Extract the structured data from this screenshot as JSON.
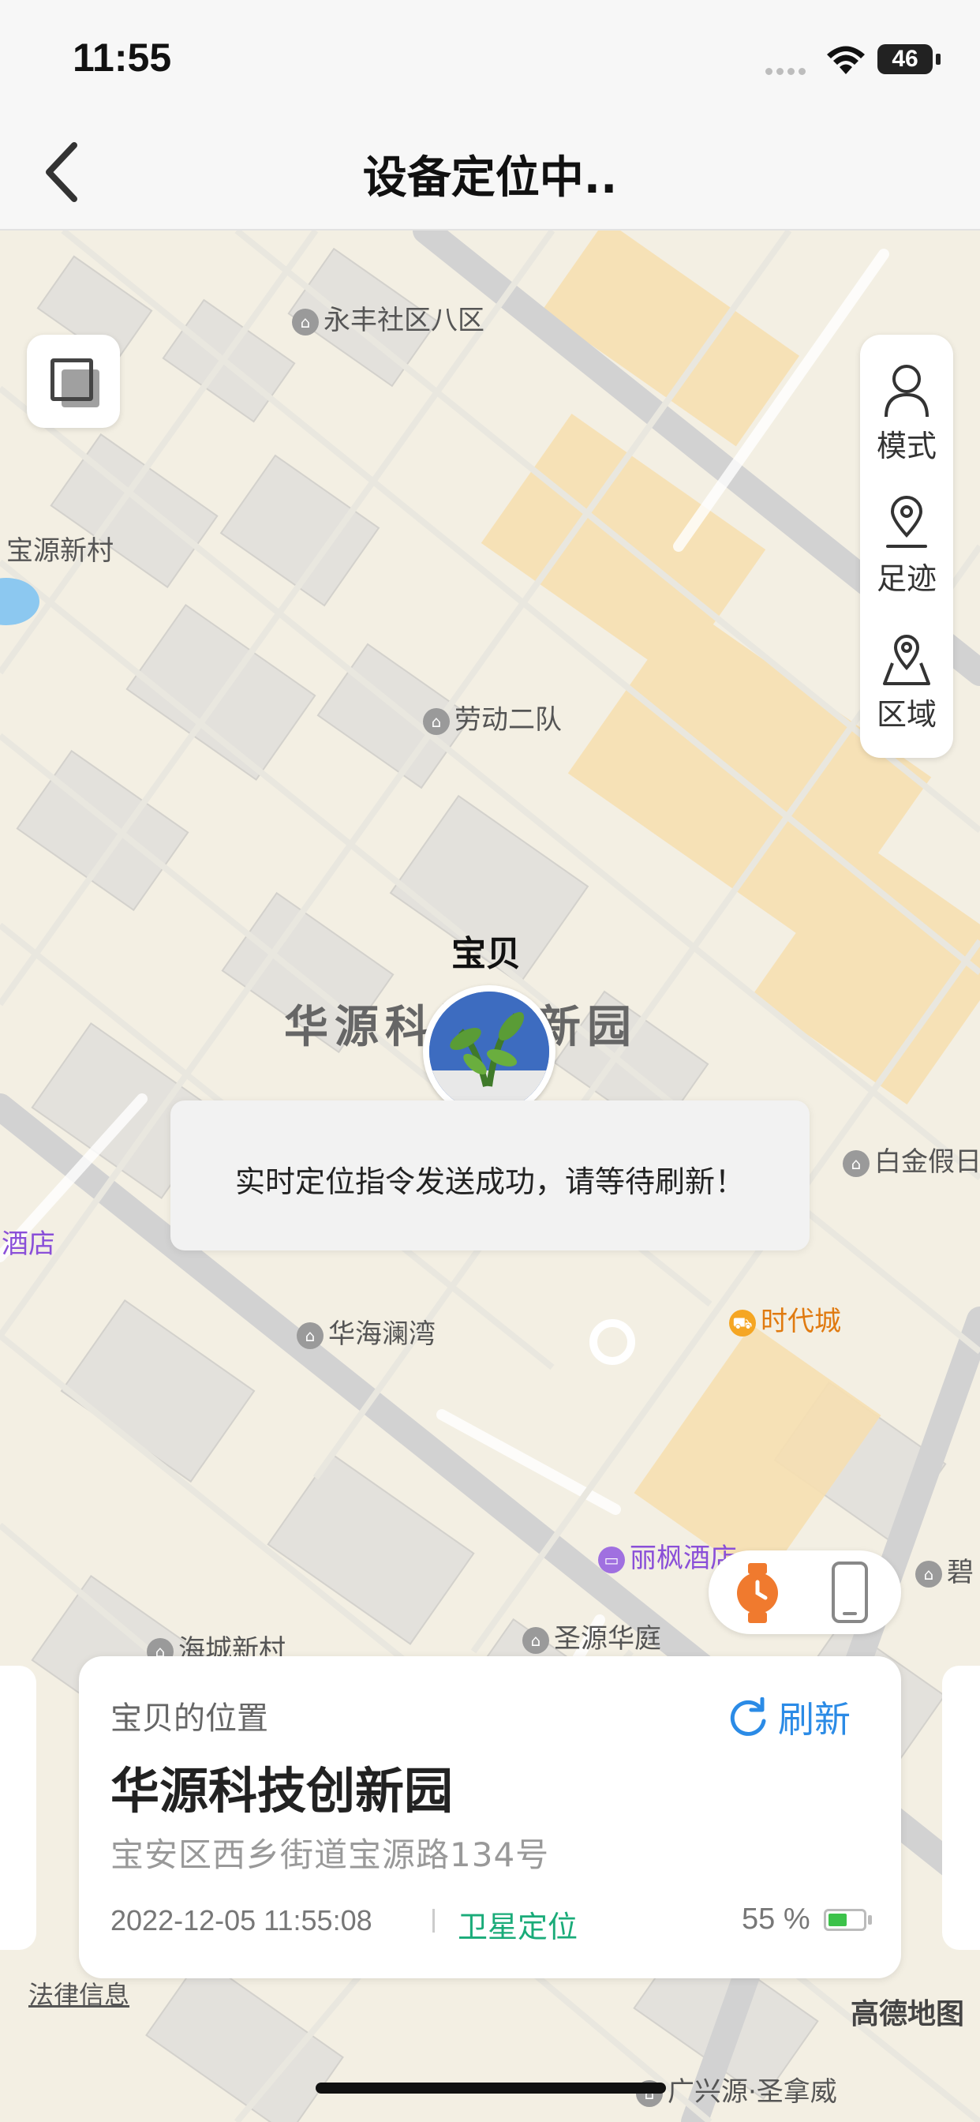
{
  "status_bar": {
    "time": "11:55",
    "battery": "46"
  },
  "nav": {
    "title": "设备定位中.."
  },
  "map": {
    "pois": [
      {
        "label": "永丰社区八区",
        "kind": "residential"
      },
      {
        "label": "宝源新村",
        "kind": "text"
      },
      {
        "label": "劳动二队",
        "kind": "residential"
      },
      {
        "label": "酒店",
        "kind": "hotel-text"
      },
      {
        "label": "白金假日",
        "kind": "residential"
      },
      {
        "label": "华海澜湾",
        "kind": "residential"
      },
      {
        "label": "时代城",
        "kind": "shop"
      },
      {
        "label": "丽枫酒店",
        "kind": "hotel"
      },
      {
        "label": "碧",
        "kind": "residential"
      },
      {
        "label": "海城新村",
        "kind": "residential"
      },
      {
        "label": "圣源华庭",
        "kind": "residential"
      },
      {
        "label": "广兴源·圣拿威",
        "kind": "residential"
      }
    ],
    "area_label": "华源科技创新园",
    "marker_label": "宝贝"
  },
  "side_menu": {
    "mode": "模式",
    "track": "足迹",
    "zone": "区域"
  },
  "toast": "实时定位指令发送成功，请等待刷新！",
  "card": {
    "label": "宝贝的位置",
    "refresh": "刷新",
    "name": "华源科技创新园",
    "address": "宝安区西乡街道宝源路134号",
    "time": "2022-12-05 11:55:08",
    "locate_type": "卫星定位",
    "battery": "55 %",
    "battery_level": 0.55
  },
  "footer": {
    "legal": "法律信息",
    "amap": "高德地图"
  },
  "colors": {
    "accent": "#2b8be6",
    "satellite": "#1aab79",
    "watch": "#f07a2e"
  }
}
